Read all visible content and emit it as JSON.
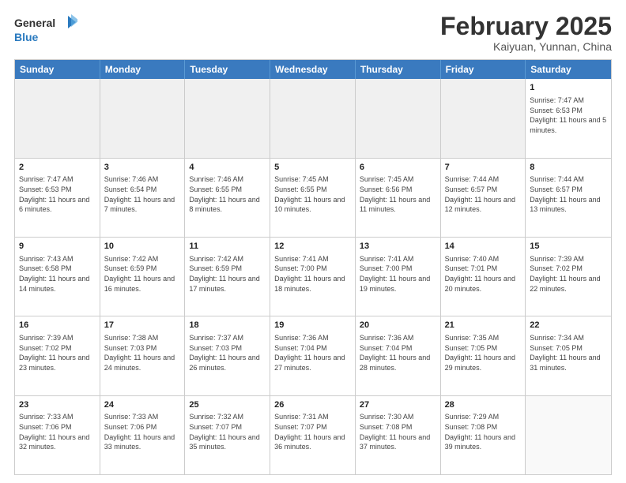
{
  "header": {
    "logo_general": "General",
    "logo_blue": "Blue",
    "month_year": "February 2025",
    "location": "Kaiyuan, Yunnan, China"
  },
  "weekdays": [
    "Sunday",
    "Monday",
    "Tuesday",
    "Wednesday",
    "Thursday",
    "Friday",
    "Saturday"
  ],
  "rows": [
    [
      {
        "day": "",
        "info": ""
      },
      {
        "day": "",
        "info": ""
      },
      {
        "day": "",
        "info": ""
      },
      {
        "day": "",
        "info": ""
      },
      {
        "day": "",
        "info": ""
      },
      {
        "day": "",
        "info": ""
      },
      {
        "day": "1",
        "info": "Sunrise: 7:47 AM\nSunset: 6:53 PM\nDaylight: 11 hours\nand 5 minutes."
      }
    ],
    [
      {
        "day": "2",
        "info": "Sunrise: 7:47 AM\nSunset: 6:53 PM\nDaylight: 11 hours\nand 6 minutes."
      },
      {
        "day": "3",
        "info": "Sunrise: 7:46 AM\nSunset: 6:54 PM\nDaylight: 11 hours\nand 7 minutes."
      },
      {
        "day": "4",
        "info": "Sunrise: 7:46 AM\nSunset: 6:55 PM\nDaylight: 11 hours\nand 8 minutes."
      },
      {
        "day": "5",
        "info": "Sunrise: 7:45 AM\nSunset: 6:55 PM\nDaylight: 11 hours\nand 10 minutes."
      },
      {
        "day": "6",
        "info": "Sunrise: 7:45 AM\nSunset: 6:56 PM\nDaylight: 11 hours\nand 11 minutes."
      },
      {
        "day": "7",
        "info": "Sunrise: 7:44 AM\nSunset: 6:57 PM\nDaylight: 11 hours\nand 12 minutes."
      },
      {
        "day": "8",
        "info": "Sunrise: 7:44 AM\nSunset: 6:57 PM\nDaylight: 11 hours\nand 13 minutes."
      }
    ],
    [
      {
        "day": "9",
        "info": "Sunrise: 7:43 AM\nSunset: 6:58 PM\nDaylight: 11 hours\nand 14 minutes."
      },
      {
        "day": "10",
        "info": "Sunrise: 7:42 AM\nSunset: 6:59 PM\nDaylight: 11 hours\nand 16 minutes."
      },
      {
        "day": "11",
        "info": "Sunrise: 7:42 AM\nSunset: 6:59 PM\nDaylight: 11 hours\nand 17 minutes."
      },
      {
        "day": "12",
        "info": "Sunrise: 7:41 AM\nSunset: 7:00 PM\nDaylight: 11 hours\nand 18 minutes."
      },
      {
        "day": "13",
        "info": "Sunrise: 7:41 AM\nSunset: 7:00 PM\nDaylight: 11 hours\nand 19 minutes."
      },
      {
        "day": "14",
        "info": "Sunrise: 7:40 AM\nSunset: 7:01 PM\nDaylight: 11 hours\nand 20 minutes."
      },
      {
        "day": "15",
        "info": "Sunrise: 7:39 AM\nSunset: 7:02 PM\nDaylight: 11 hours\nand 22 minutes."
      }
    ],
    [
      {
        "day": "16",
        "info": "Sunrise: 7:39 AM\nSunset: 7:02 PM\nDaylight: 11 hours\nand 23 minutes."
      },
      {
        "day": "17",
        "info": "Sunrise: 7:38 AM\nSunset: 7:03 PM\nDaylight: 11 hours\nand 24 minutes."
      },
      {
        "day": "18",
        "info": "Sunrise: 7:37 AM\nSunset: 7:03 PM\nDaylight: 11 hours\nand 26 minutes."
      },
      {
        "day": "19",
        "info": "Sunrise: 7:36 AM\nSunset: 7:04 PM\nDaylight: 11 hours\nand 27 minutes."
      },
      {
        "day": "20",
        "info": "Sunrise: 7:36 AM\nSunset: 7:04 PM\nDaylight: 11 hours\nand 28 minutes."
      },
      {
        "day": "21",
        "info": "Sunrise: 7:35 AM\nSunset: 7:05 PM\nDaylight: 11 hours\nand 29 minutes."
      },
      {
        "day": "22",
        "info": "Sunrise: 7:34 AM\nSunset: 7:05 PM\nDaylight: 11 hours\nand 31 minutes."
      }
    ],
    [
      {
        "day": "23",
        "info": "Sunrise: 7:33 AM\nSunset: 7:06 PM\nDaylight: 11 hours\nand 32 minutes."
      },
      {
        "day": "24",
        "info": "Sunrise: 7:33 AM\nSunset: 7:06 PM\nDaylight: 11 hours\nand 33 minutes."
      },
      {
        "day": "25",
        "info": "Sunrise: 7:32 AM\nSunset: 7:07 PM\nDaylight: 11 hours\nand 35 minutes."
      },
      {
        "day": "26",
        "info": "Sunrise: 7:31 AM\nSunset: 7:07 PM\nDaylight: 11 hours\nand 36 minutes."
      },
      {
        "day": "27",
        "info": "Sunrise: 7:30 AM\nSunset: 7:08 PM\nDaylight: 11 hours\nand 37 minutes."
      },
      {
        "day": "28",
        "info": "Sunrise: 7:29 AM\nSunset: 7:08 PM\nDaylight: 11 hours\nand 39 minutes."
      },
      {
        "day": "",
        "info": ""
      }
    ]
  ]
}
